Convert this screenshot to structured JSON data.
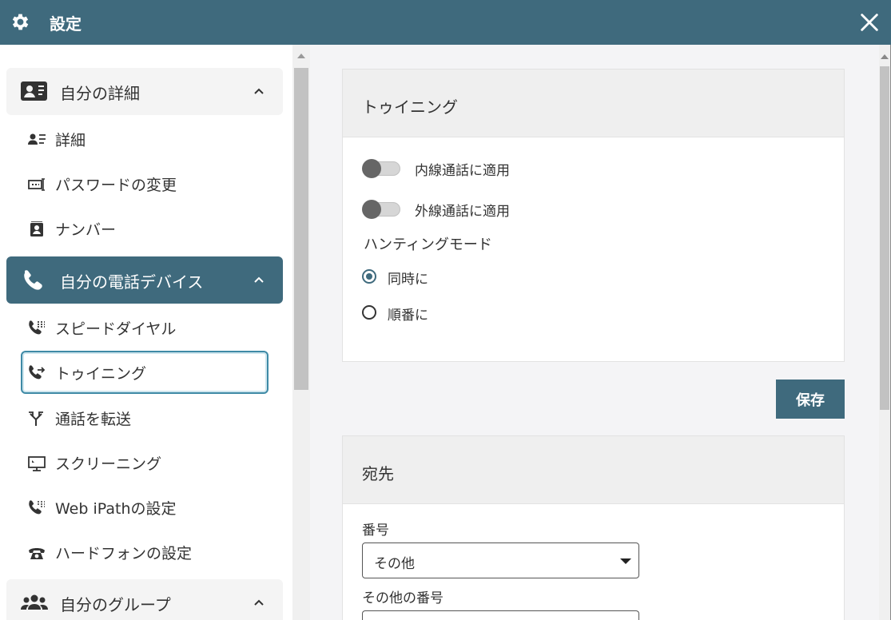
{
  "window": {
    "title": "設定"
  },
  "sidebar": {
    "sections": [
      {
        "label": "自分の詳細",
        "icon": "contact-card-icon",
        "expanded": true,
        "items": [
          {
            "label": "詳細",
            "icon": "person-details-icon"
          },
          {
            "label": "パスワードの変更",
            "icon": "password-icon"
          },
          {
            "label": "ナンバー",
            "icon": "number-badge-icon"
          }
        ]
      },
      {
        "label": "自分の電話デバイス",
        "icon": "phone-icon",
        "expanded": true,
        "active": true,
        "items": [
          {
            "label": "スピードダイヤル",
            "icon": "speed-dial-icon"
          },
          {
            "label": "トゥイニング",
            "icon": "twinning-icon",
            "selected": true
          },
          {
            "label": "通話を転送",
            "icon": "call-forward-icon"
          },
          {
            "label": "スクリーニング",
            "icon": "screening-icon"
          },
          {
            "label": "Web iPathの設定",
            "icon": "web-ipath-icon"
          },
          {
            "label": "ハードフォンの設定",
            "icon": "hardphone-icon"
          }
        ]
      },
      {
        "label": "自分のグループ",
        "icon": "group-icon",
        "expanded": true
      }
    ]
  },
  "twinning_card": {
    "title": "トゥイニング",
    "toggles": [
      {
        "label": "内線通話に適用",
        "on": false
      },
      {
        "label": "外線通話に適用",
        "on": false
      }
    ],
    "hunting_mode": {
      "label": "ハンティングモード",
      "options": [
        {
          "label": "同時に",
          "selected": true
        },
        {
          "label": "順番に",
          "selected": false
        }
      ]
    }
  },
  "save_button": {
    "label": "保存"
  },
  "destination_card": {
    "title": "宛先",
    "number_label": "番号",
    "number_value": "その他",
    "other_number_label": "その他の番号"
  },
  "colors": {
    "accent": "#3f6a7d",
    "selected_outline": "#3f8aa6"
  }
}
